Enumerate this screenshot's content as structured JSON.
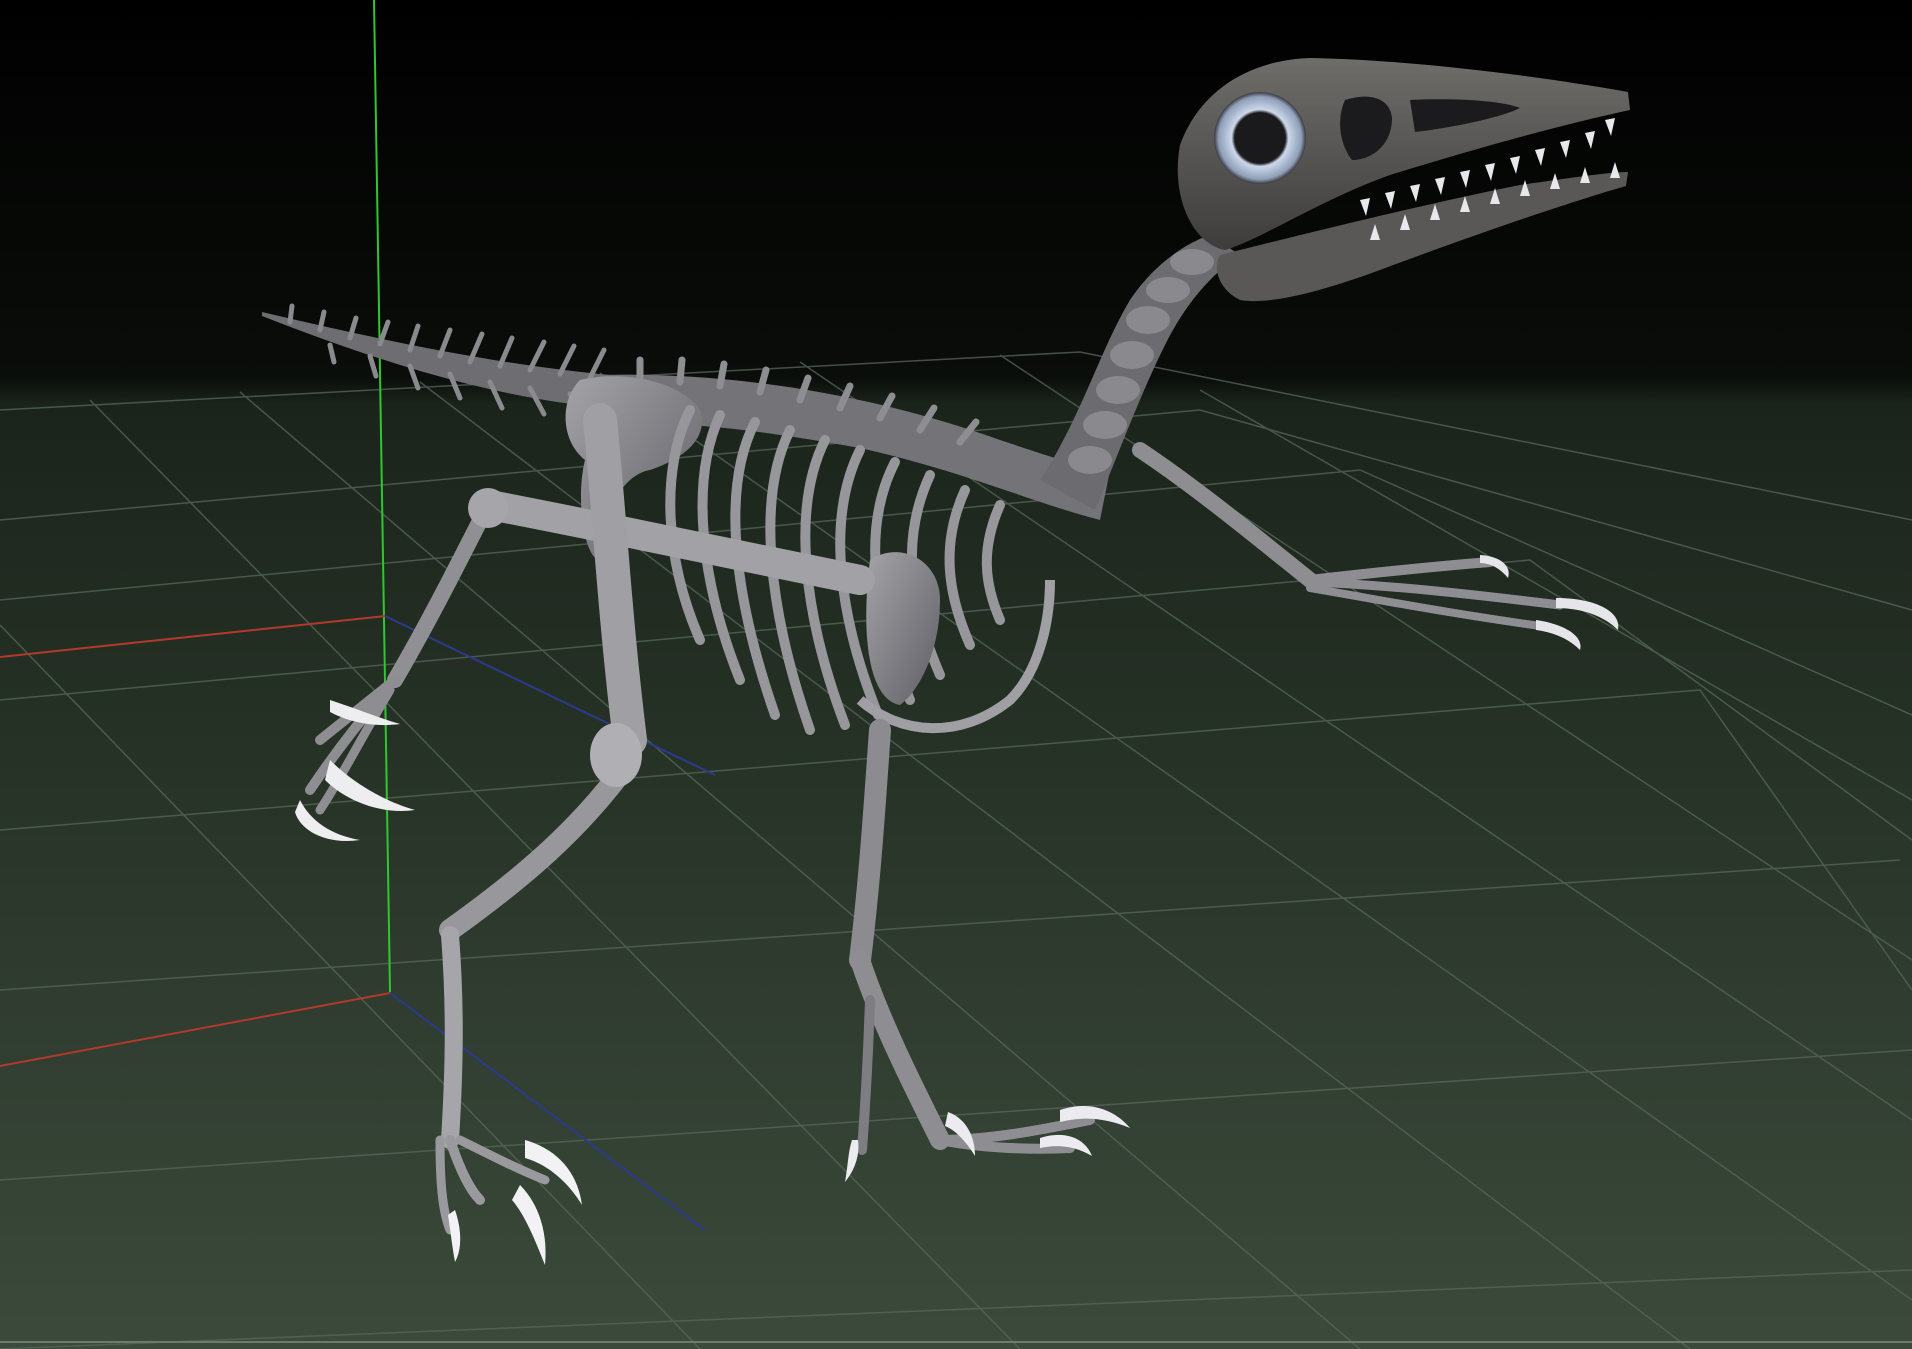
{
  "viewport": {
    "background_top": "#000000",
    "background_bottom": "#3b4638",
    "floor_color": "#2e3a2c",
    "grid_color": "#5a6a58",
    "axis_colors": {
      "x": "#c8382b",
      "y": "#2ed12e",
      "z": "#2f3f9e"
    }
  },
  "model": {
    "subject": "theropod-dinosaur-skeleton",
    "bone_color": "#8f8f93",
    "bone_shadow": "#56565c",
    "claw_color": "#e6e6ea",
    "eye_ring_color": "#b7c8e0"
  }
}
